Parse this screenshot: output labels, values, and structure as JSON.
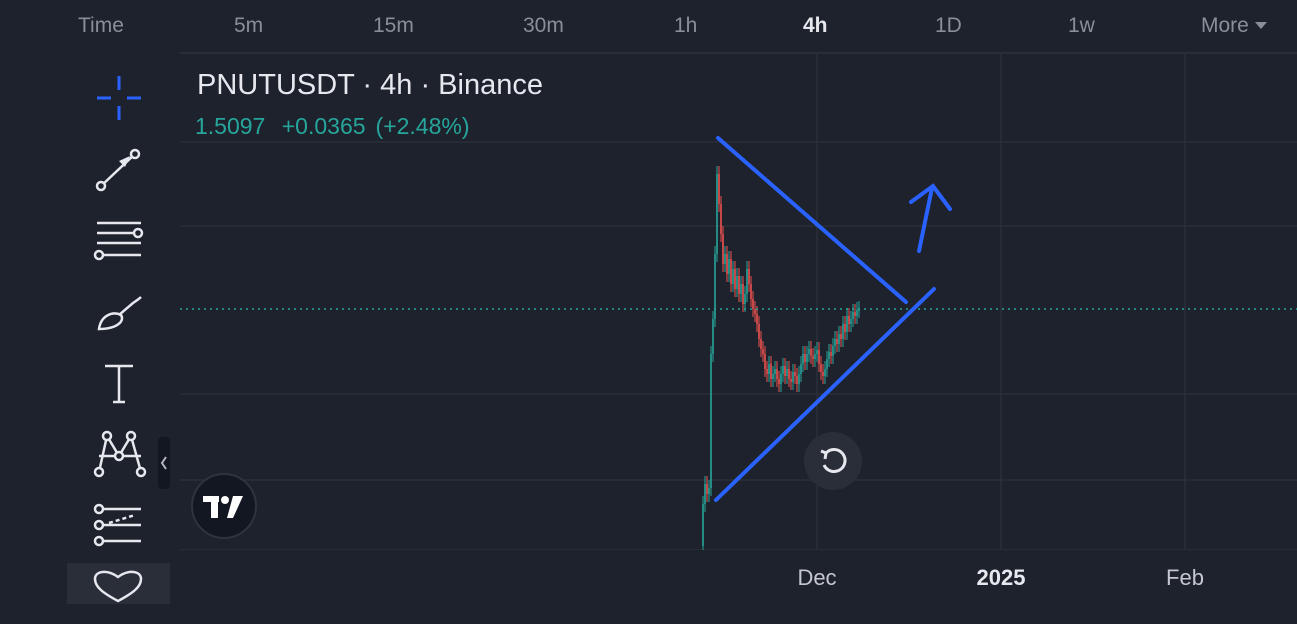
{
  "timeframes": {
    "time": "Time",
    "m5": "5m",
    "m15": "15m",
    "m30": "30m",
    "h1": "1h",
    "h4": "4h",
    "d1": "1D",
    "w1": "1w",
    "more": "More"
  },
  "active_timeframe": "4h",
  "toolbar": {
    "tools": [
      "crosshair-icon",
      "trend-line-icon",
      "fib-retracement-icon",
      "brush-icon",
      "text-icon",
      "pattern-icon",
      "forecast-icon",
      "favorites-icon"
    ]
  },
  "chart": {
    "title": "PNUTUSDT · 4h · Binance",
    "price": "1.5097",
    "change": "+0.0365",
    "change_pct": "(+2.48%)",
    "x_labels": [
      "Dec",
      "2025",
      "Feb"
    ],
    "colors": {
      "background": "#1e222d",
      "up": "#26a69a",
      "down": "#ef5350",
      "drawing": "#2962ff",
      "price_line": "#26a69a",
      "grid": "#2a2e39"
    }
  }
}
